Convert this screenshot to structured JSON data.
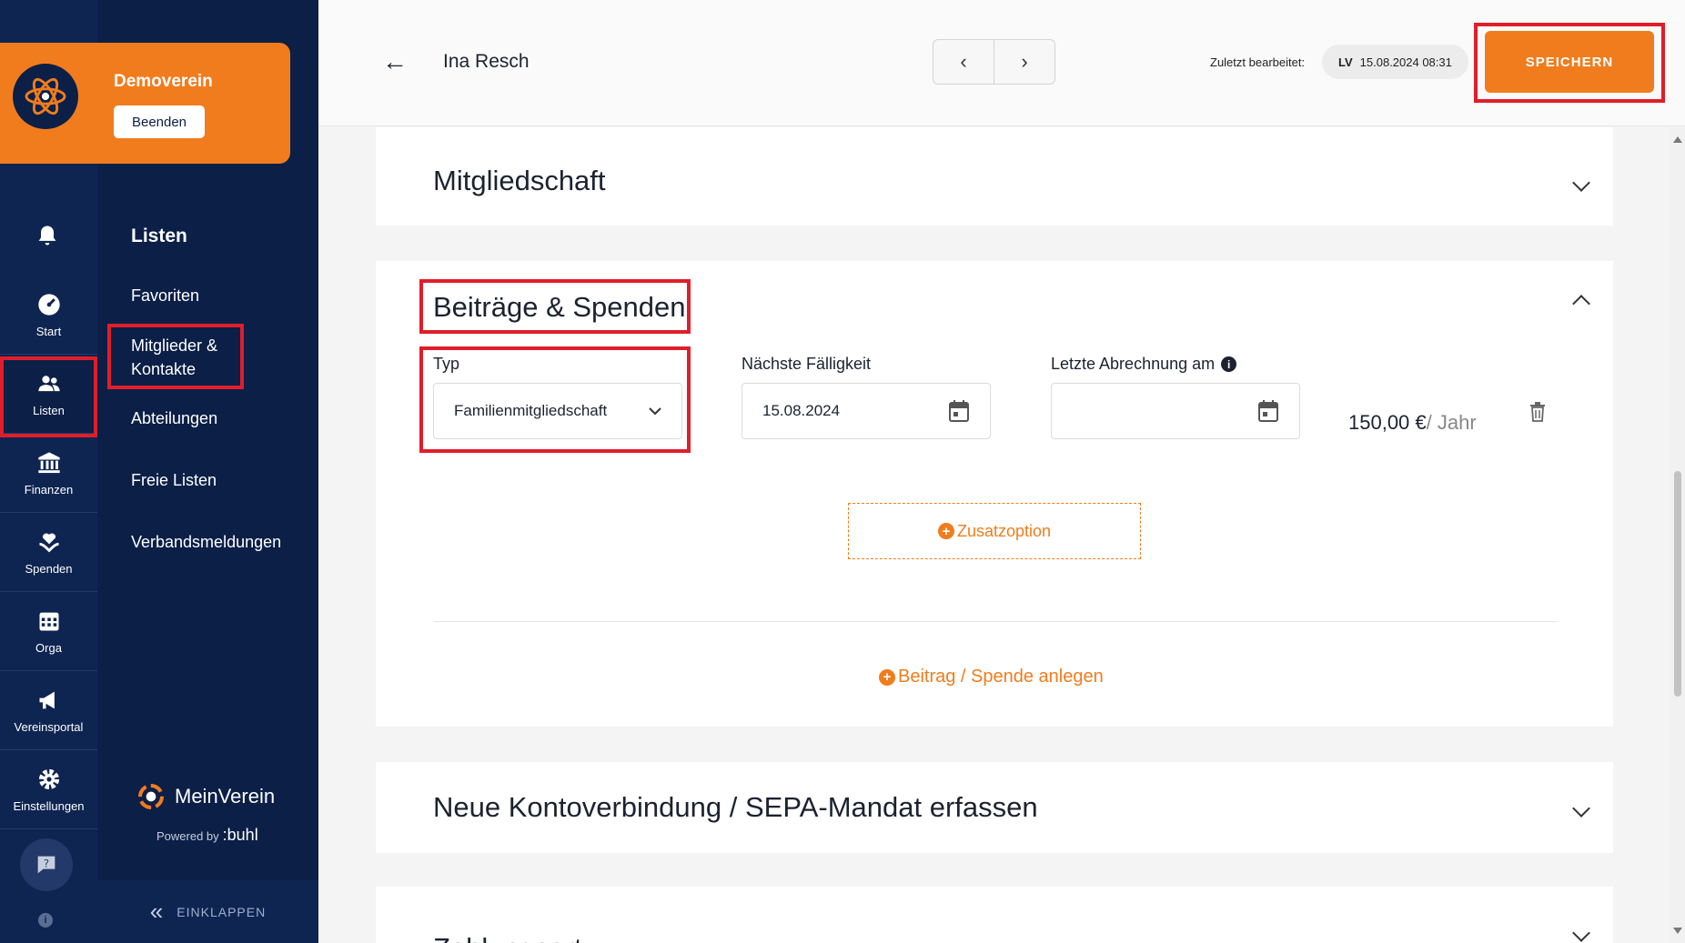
{
  "club": {
    "name": "Demoverein",
    "quit_label": "Beenden"
  },
  "rail": {
    "items": [
      {
        "label": "Start",
        "icon": "speedometer-icon"
      },
      {
        "label": "Listen",
        "icon": "users-icon"
      },
      {
        "label": "Finanzen",
        "icon": "bank-icon"
      },
      {
        "label": "Spenden",
        "icon": "donation-icon"
      },
      {
        "label": "Orga",
        "icon": "calendar-icon"
      },
      {
        "label": "Vereinsportal",
        "icon": "megaphone-icon"
      },
      {
        "label": "Einstellungen",
        "icon": "gear-icon"
      }
    ]
  },
  "nav": {
    "title": "Listen",
    "items": [
      "Favoriten",
      "Mitglieder & Kontakte",
      "Abteilungen",
      "Freie Listen",
      "Verbandsmeldungen"
    ]
  },
  "brand": {
    "name": "MeinVerein",
    "powered_by": "Powered by",
    "company": ":buhl"
  },
  "collapse_label": "EINKLAPPEN",
  "header": {
    "back_icon": "←",
    "person_name": "Ina Resch",
    "prev_icon": "‹",
    "next_icon": "›",
    "last_edited_label": "Zuletzt bearbeitet:",
    "editor_initials": "LV",
    "edited_at": "15.08.2024 08:31",
    "save_label": "SPEICHERN"
  },
  "sections": {
    "membership": {
      "title": "Mitgliedschaft"
    },
    "contributions": {
      "title": "Beiträge & Spenden",
      "type_label": "Typ",
      "type_value": "Familienmitgliedschaft",
      "due_label": "Nächste Fälligkeit",
      "due_value": "15.08.2024",
      "last_billing_label": "Letzte Abrechnung am",
      "last_billing_value": "",
      "amount": "150,00 €",
      "amount_period": "/ Jahr",
      "extra_option_label": "Zusatzoption",
      "add_contribution_label": "Beitrag / Spende anlegen"
    },
    "bank": {
      "title": "Neue Kontoverbindung / SEPA-Mandat erfassen"
    },
    "payment": {
      "title": "Zahlungsart"
    }
  },
  "colors": {
    "accent": "#f17c1d",
    "sidebar": "#0e2552",
    "highlight": "#e01e2a"
  }
}
